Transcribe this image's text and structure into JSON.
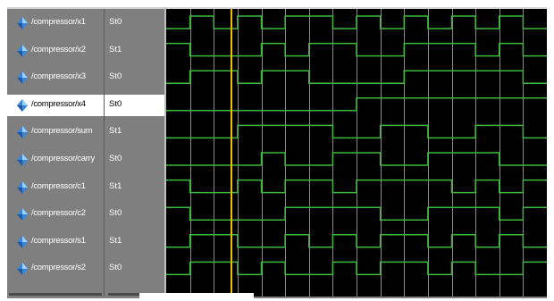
{
  "signals": [
    {
      "name": "/compressor/x1",
      "value": "St0",
      "selected": false,
      "bits": "0101011010101010"
    },
    {
      "name": "/compressor/x2",
      "value": "St1",
      "selected": false,
      "bits": "1000101100111010"
    },
    {
      "name": "/compressor/x3",
      "value": "St0",
      "selected": false,
      "bits": "0110110000111110"
    },
    {
      "name": "/compressor/x4",
      "value": "St0",
      "selected": true,
      "bits": "0000000011111111"
    },
    {
      "name": "/compressor/sum",
      "value": "St1",
      "selected": false,
      "bits": "0001111001100110"
    },
    {
      "name": "/compressor/carry",
      "value": "St0",
      "selected": false,
      "bits": "0000100110011100"
    },
    {
      "name": "/compressor/c1",
      "value": "St1",
      "selected": false,
      "bits": "1001011011110101"
    },
    {
      "name": "/compressor/c2",
      "value": "St0",
      "selected": false,
      "bits": "1000011110011101"
    },
    {
      "name": "/compressor/s1",
      "value": "St1",
      "selected": false,
      "bits": "0110010101101010"
    },
    {
      "name": "/compressor/s2",
      "value": "St0",
      "selected": false,
      "bits": "0110100101101001"
    }
  ],
  "cursor": {
    "color": "#f0c000"
  },
  "colors": {
    "wave": "#3cb83c",
    "grid": "#8a8a8a",
    "wave_background": "#000000",
    "icon": "#3a86d8"
  }
}
